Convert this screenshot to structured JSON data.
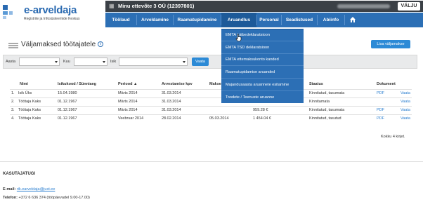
{
  "header": {
    "logo_title": "e-arveldaja",
    "logo_subtitle": "Registrite ja Infosüsteemide Keskus",
    "company_name": "Minu ettevõte 3 OÜ (12397801)",
    "logout_label": "VÄLJU"
  },
  "nav": {
    "items": [
      "Töölaud",
      "Arveldamine",
      "Raamatupidamine",
      "Aruandlus",
      "Personal",
      "Seadistused",
      "Abiinfo"
    ],
    "home_icon": "home-icon",
    "active": "Aruandlus"
  },
  "dropdown": {
    "items": [
      "EMTA käibedeklaratsioon",
      "EMTA TSD deklaratsioon",
      "EMTA ettemaksukonto kanded",
      "Raamatupidamise aruanded",
      "Majandusaasta aruannete esitamine",
      "Toodete / Teenuste aruanne"
    ]
  },
  "panel": {
    "title": "Väljamaksed töötajatele",
    "add_button": "Lisa väljamakse"
  },
  "filter": {
    "year_label": "Aasta",
    "month_label": "Kuu",
    "person_label": "Isik",
    "search_button": "Vaata"
  },
  "table": {
    "headers": [
      "Nimi",
      "Isikukood / Sünniaeg",
      "Periood ▲",
      "Arvestamise kpv",
      "Makse",
      "Staatus",
      "Dokument"
    ],
    "rows": [
      {
        "nr": "1.",
        "name": "Isik Üks",
        "code": "15.04.1980",
        "period": "Märts 2014",
        "date": "31.03.2014",
        "pay": "",
        "amount": "",
        "status": "Kinnitatud, tasumata",
        "doc": "PDF",
        "view": "Vaata"
      },
      {
        "nr": "2.",
        "name": "Töötaja Kaks",
        "code": "01.12.1967",
        "period": "Märts 2014",
        "date": "31.03.2014",
        "pay": "",
        "amount": "",
        "status": "Kinnitamata",
        "doc": "",
        "view": "Vaata"
      },
      {
        "nr": "3.",
        "name": "Töötaja Kaks",
        "code": "01.12.1967",
        "period": "Märts 2014",
        "date": "31.03.2014",
        "pay": "",
        "amount": "959.28 €",
        "status": "Kinnitatud, tasumata",
        "doc": "PDF",
        "view": "Vaata"
      },
      {
        "nr": "4.",
        "name": "Töötaja Kaks",
        "code": "01.12.1967",
        "period": "Veebruar 2014",
        "date": "28.02.2014",
        "pay": "05.03.2014",
        "amount": "1 454.04 €",
        "status": "Kinnitatud, tasutud",
        "doc": "PDF",
        "view": "Vaata"
      }
    ],
    "totals": "Kokku 4 kirjet."
  },
  "footer": {
    "title": "KASUTAJATUGI",
    "email_label": "E-mail:",
    "email": "rik.earveldaja@just.ee",
    "phone_label": "Telefon:",
    "phone": "+372 6 636 374 (tööpäevadel 9.00-17.00)"
  },
  "colors": {
    "nav_blue": "#2c6fb5",
    "button_blue": "#2c8ad6",
    "company_bar": "#3b4046"
  }
}
